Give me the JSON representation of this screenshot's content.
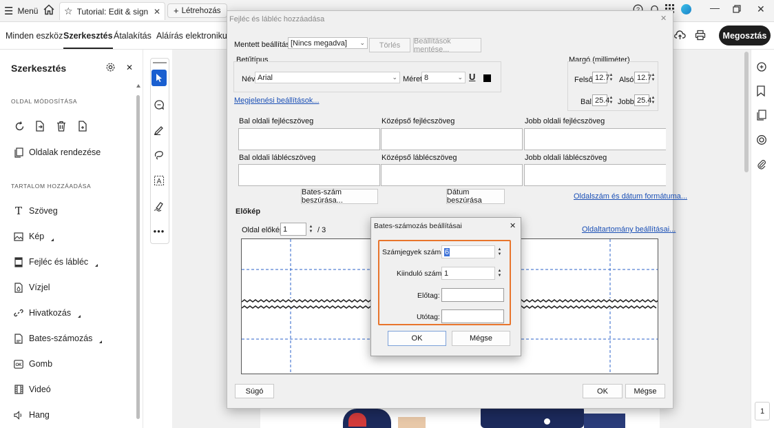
{
  "topbar": {
    "menu_label": "Menü",
    "tab_title": "Tutorial: Edit & sign ...",
    "new_tab_label": "Létrehozás"
  },
  "nav": {
    "tabs": [
      "Minden eszköz",
      "Szerkesztés",
      "Átalakítás",
      "Aláírás elektronikusan"
    ],
    "share_label": "Megosztás"
  },
  "left_panel": {
    "title": "Szerkesztés",
    "section_pages": "OLDAL MÓDOSÍTÁSA",
    "arrange_pages": "Oldalak rendezése",
    "section_content": "TARTALOM HOZZÁADÁSA",
    "items": [
      "Szöveg",
      "Kép",
      "Fejléc és lábléc",
      "Vízjel",
      "Hivatkozás",
      "Bates-számozás",
      "Gomb",
      "Videó",
      "Hang"
    ]
  },
  "right_rail": {
    "page_number": "1"
  },
  "dialog": {
    "title": "Fejléc és lábléc hozzáadása",
    "saved_settings_label": "Mentett beállítások:",
    "saved_settings_value": "[Nincs megadva]",
    "delete_btn": "Törlés",
    "save_settings_btn": "Beállítások mentése...",
    "font_group": "Betűtípus",
    "name_label": "Név:",
    "font_name": "Arial",
    "size_label": "Méret:",
    "font_size": "8",
    "underline_glyph": "U",
    "margin_group": "Margó (milliméter)",
    "top_label": "Felső:",
    "top_value": "12.7",
    "bottom_label": "Alsó:",
    "bottom_value": "12.7",
    "left_label": "Bal:",
    "left_value": "25.4",
    "right_label": "Jobb:",
    "right_value": "25.4",
    "appearance_link": "Megjelenési beállítások...",
    "left_header": "Bal oldali fejlécszöveg",
    "center_header": "Középső fejlécszöveg",
    "right_header": "Jobb oldali fejlécszöveg",
    "left_footer": "Bal oldali láblécszöveg",
    "center_footer": "Középső láblécszöveg",
    "right_footer": "Jobb oldali láblécszöveg",
    "insert_bates_btn": "Bates-szám beszúrása...",
    "insert_date_btn": "Dátum beszúrása",
    "format_link": "Oldalszám és dátum formátuma...",
    "preview_label": "Előkép",
    "page_preview_label": "Oldal előképe",
    "page_preview_value": "1",
    "page_total": "/ 3",
    "page_range_link": "Oldaltartomány beállításai...",
    "help_btn": "Súgó",
    "ok_btn": "OK",
    "cancel_btn": "Mégse"
  },
  "bates": {
    "title": "Bates-számozás beállításai",
    "digits_label": "Számjegyek száma:",
    "digits_value": "6",
    "start_label": "Kiinduló szám:",
    "start_value": "1",
    "prefix_label": "Előtag:",
    "prefix_value": "",
    "suffix_label": "Utótag:",
    "suffix_value": "",
    "ok_btn": "OK",
    "cancel_btn": "Mégse"
  },
  "colors": {
    "highlight": "#e8742b",
    "accent": "#1a5fd0",
    "link": "#1a4fb5"
  }
}
